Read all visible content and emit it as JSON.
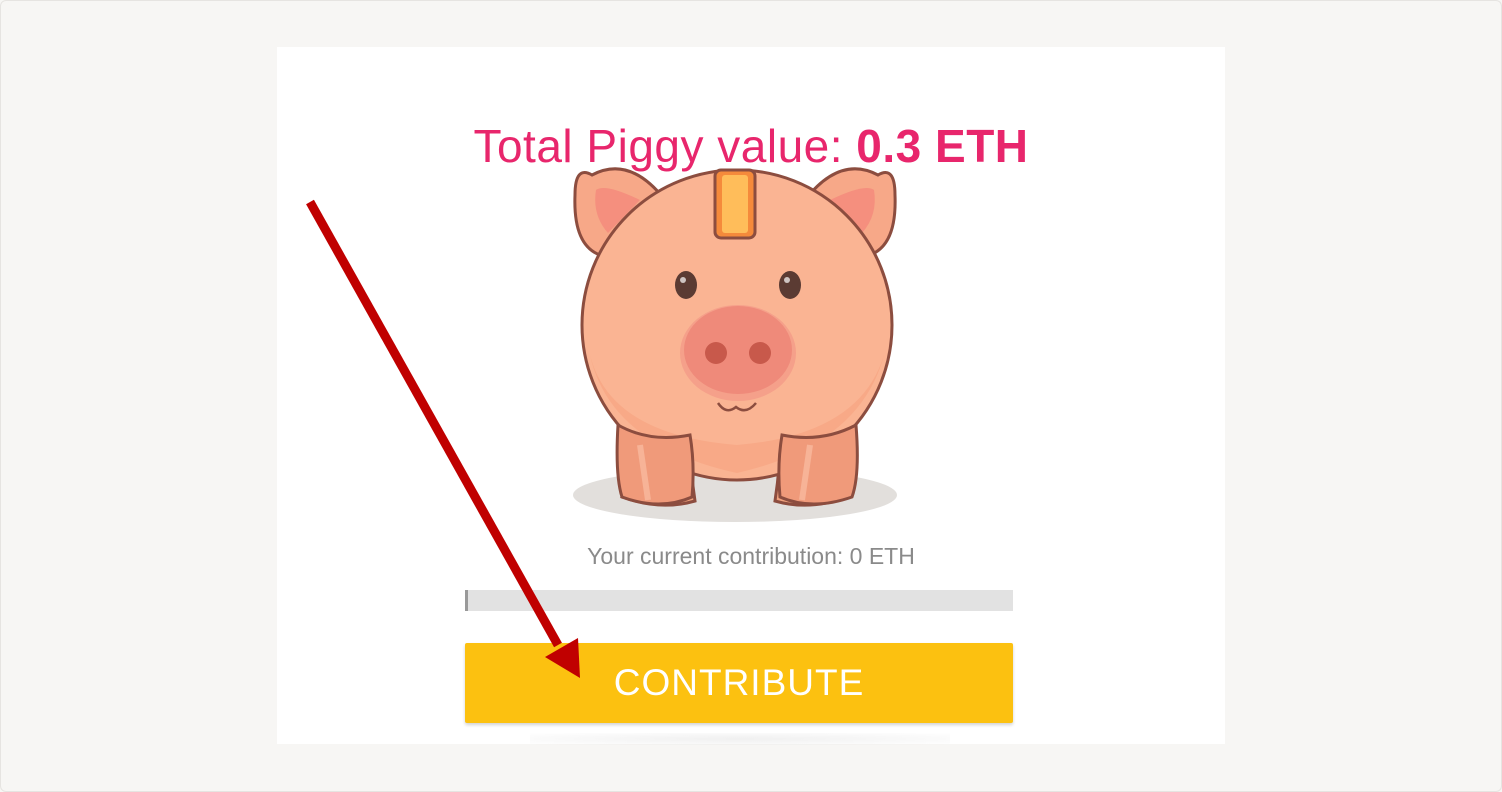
{
  "header": {
    "title_prefix": "Total Piggy value: ",
    "title_value": "0.3 ETH"
  },
  "contribution": {
    "text": "Your current contribution: 0 ETH",
    "progress_fraction": 0
  },
  "actions": {
    "contribute_label": "CONTRIBUTE"
  },
  "colors": {
    "title": "#e8266c",
    "button": "#fcc110",
    "annotation_arrow": "#c00000"
  },
  "icons": {
    "mascot": "piggy-bank-icon",
    "annotation": "arrow-annotation"
  }
}
